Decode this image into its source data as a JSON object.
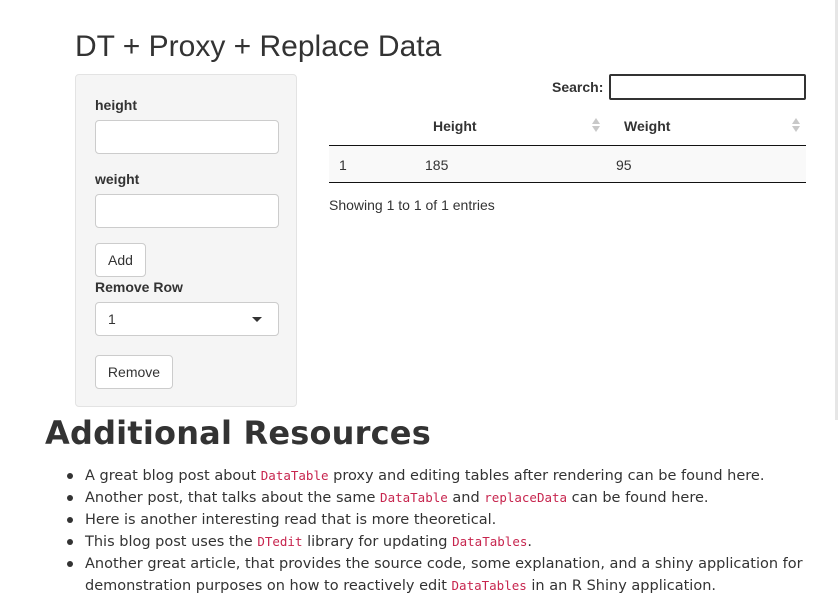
{
  "app": {
    "title": "DT + Proxy + Replace Data"
  },
  "sidebar": {
    "height_label": "height",
    "height_value": "",
    "weight_label": "weight",
    "weight_value": "",
    "add_button": "Add",
    "remove_row_label": "Remove Row",
    "remove_row_selected": "1",
    "remove_button": "Remove"
  },
  "table": {
    "search_label": "Search:",
    "search_value": "",
    "columns": [
      "",
      "Height",
      "Weight"
    ],
    "rows": [
      [
        "1",
        "185",
        "95"
      ]
    ],
    "info": "Showing 1 to 1 of 1 entries"
  },
  "resources": {
    "title": "Additional Resources",
    "items": [
      {
        "t1": "A great blog post about ",
        "c1": "DataTable",
        "t2": " proxy and editing tables after rendering can be found here."
      },
      {
        "t1": "Another post, that talks about the same ",
        "c1": "DataTable",
        "t2": " and ",
        "c2": "replaceData",
        "t3": " can be found here."
      },
      {
        "t1": "Here is another interesting read that is more theoretical."
      },
      {
        "t1": "This blog post uses the ",
        "c1": "DTedit",
        "t2": " library for updating ",
        "c2": "DataTables",
        "t3": "."
      },
      {
        "t1": "Another great article, that provides the source code, some explanation, and a shiny application for demonstration purposes on how to reactively edit ",
        "c1": "DataTables",
        "t2": " in an R Shiny application."
      }
    ]
  },
  "colors": {
    "code_text": "#c7254e",
    "sidebar_bg": "#f5f5f5",
    "row_striped_bg": "#f9f9f9"
  }
}
